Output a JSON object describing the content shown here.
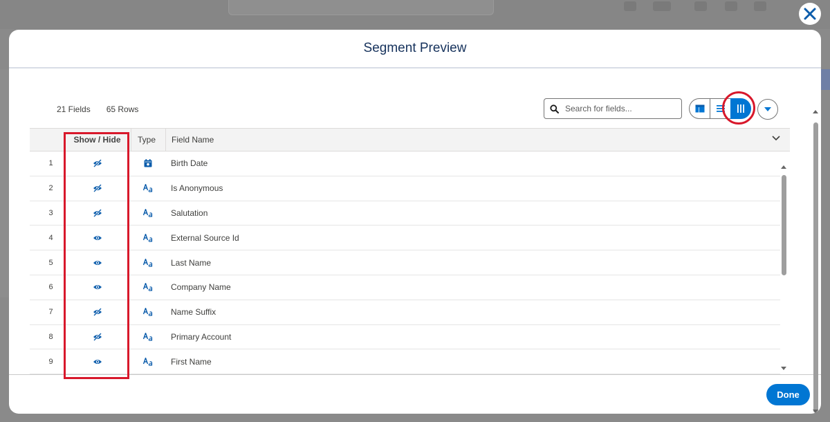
{
  "modal": {
    "title": "Segment Preview",
    "fields_count": "21 Fields",
    "rows_count": "65 Rows",
    "search_placeholder": "Search for fields...",
    "done_label": "Done"
  },
  "table": {
    "columns": [
      "Show / Hide",
      "Type",
      "Field Name"
    ],
    "rows": [
      {
        "num": "1",
        "visible": false,
        "type": "date-icon",
        "field": "Birth Date"
      },
      {
        "num": "2",
        "visible": false,
        "type": "text-icon",
        "field": "Is Anonymous"
      },
      {
        "num": "3",
        "visible": false,
        "type": "text-icon",
        "field": "Salutation"
      },
      {
        "num": "4",
        "visible": true,
        "type": "text-icon",
        "field": "External Source Id"
      },
      {
        "num": "5",
        "visible": true,
        "type": "text-icon",
        "field": "Last Name"
      },
      {
        "num": "6",
        "visible": true,
        "type": "text-icon",
        "field": "Company Name"
      },
      {
        "num": "7",
        "visible": false,
        "type": "text-icon",
        "field": "Name Suffix"
      },
      {
        "num": "8",
        "visible": false,
        "type": "text-icon",
        "field": "Primary Account"
      },
      {
        "num": "9",
        "visible": true,
        "type": "text-icon",
        "field": "First Name"
      }
    ]
  },
  "colors": {
    "brand": "#0176d3",
    "highlight": "#d8182b"
  }
}
